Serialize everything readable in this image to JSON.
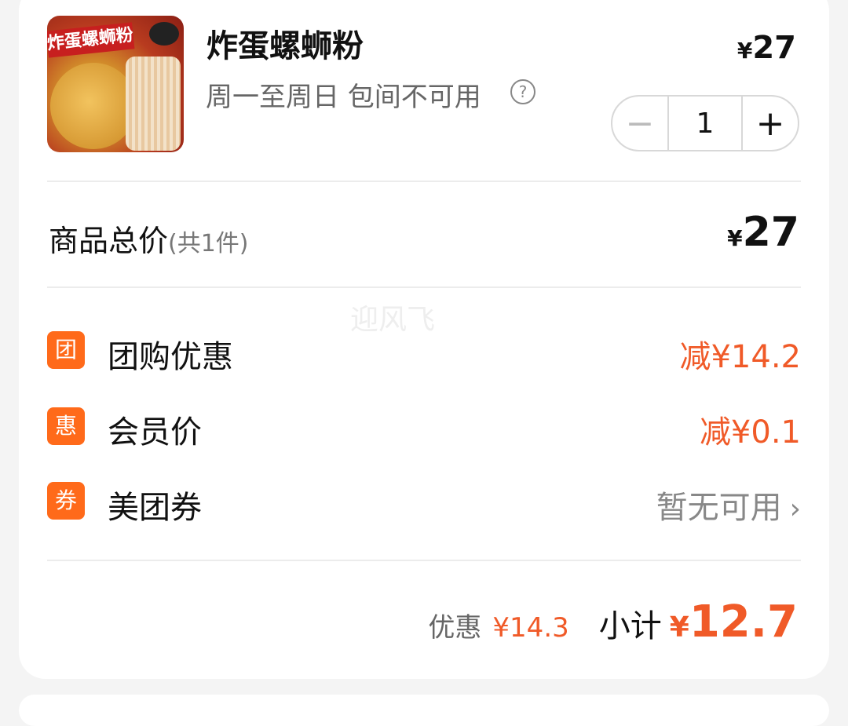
{
  "product": {
    "image_banner": "炸蛋螺蛳粉",
    "title": "炸蛋螺蛳粉",
    "subtitle": "周一至周日 包间不可用",
    "price_currency": "¥",
    "price_amount": "27",
    "quantity": "1",
    "help_icon": "question-circle-icon"
  },
  "summary": {
    "label": "商品总价",
    "count": "(共1件)",
    "price_currency": "¥",
    "price_amount": "27"
  },
  "watermark": "迎风飞",
  "discounts": [
    {
      "icon_text": "团",
      "label": "团购优惠",
      "value": "减¥14.2"
    },
    {
      "icon_text": "惠",
      "label": "会员价",
      "value": "减¥0.1"
    },
    {
      "icon_text": "券",
      "label": "美团券",
      "value": "暂无可用"
    }
  ],
  "footer": {
    "save_label": "优惠",
    "save_amount": "¥14.3",
    "subtotal_label": "小计",
    "subtotal_currency": "¥",
    "subtotal_amount": "12.7"
  },
  "colors": {
    "accent": "#f05a28",
    "icon_bg": "#ff6a1a"
  }
}
